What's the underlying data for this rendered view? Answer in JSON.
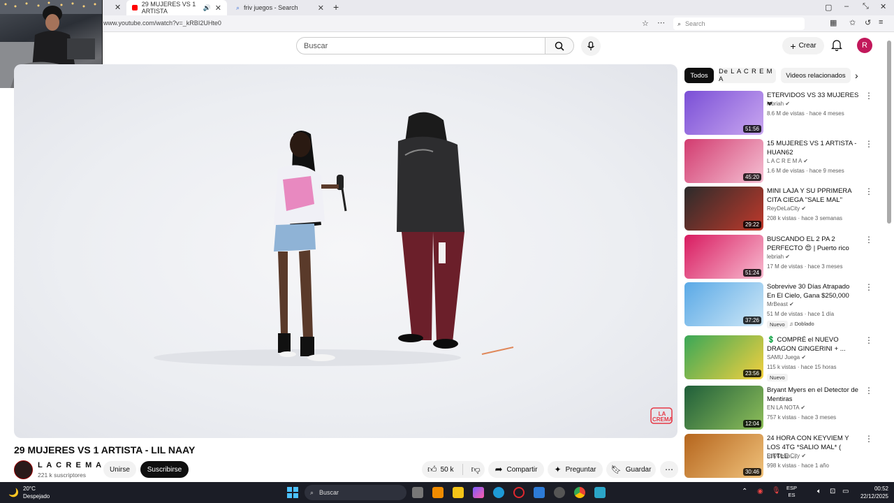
{
  "browser": {
    "tabs": [
      {
        "title": "29 MUJERES VS 1 ARTISTA",
        "active": true
      },
      {
        "title": "friv juegos - Search",
        "active": false
      }
    ],
    "url": "www.youtube.com/watch?v=_kRBI2UHte0",
    "search_placeholder": "Search"
  },
  "header": {
    "search_placeholder": "Buscar",
    "create_label": "Crear",
    "avatar_letter": "R"
  },
  "video": {
    "title": "29 MUJERES VS 1 ARTISTA - LIL NAAY",
    "watermark": "LA CREMA",
    "channel_name": "L A C R E M A",
    "subscribers": "221 k suscriptores",
    "join_label": "Unirse",
    "subscribe_label": "Suscribirse",
    "likes": "50 k",
    "share_label": "Compartir",
    "ask_label": "Preguntar",
    "save_label": "Guardar"
  },
  "chips": [
    "Todos",
    "De L A C R E M A",
    "Videos relacionados"
  ],
  "recommendations": [
    {
      "title": "ETERVIDOS VS 33 MUJERES ❤",
      "channel": "lebriah",
      "meta": "8.6 M de vistas · hace 4 meses",
      "duration": "51:56",
      "thumb_colors": [
        "#7a4fd6",
        "#c9a7f0"
      ]
    },
    {
      "title": "15 MUJERES VS 1 ARTISTA - HUAN62",
      "channel": "L A C R E M A",
      "meta": "1.6 M de vistas · hace 9 meses",
      "duration": "45:20",
      "thumb_colors": [
        "#d23b6f",
        "#f5c1d4"
      ]
    },
    {
      "title": "MINI LAJA Y SU PPRIMERA CITA CIEGA \"SALE MAL\"",
      "channel": "ReyDeLaCity",
      "meta": "208 k vistas · hace 3 semanas",
      "duration": "29:22",
      "thumb_colors": [
        "#2b2b2b",
        "#c0392b"
      ]
    },
    {
      "title": "BUSCANDO EL 2 PA 2 PERFECTO 😍 | Puerto rico",
      "channel": "lebriah",
      "meta": "17 M de vistas · hace 3 meses",
      "duration": "51:24",
      "thumb_colors": [
        "#d81b60",
        "#f8bbd0"
      ]
    },
    {
      "title": "Sobrevive 30 Días Atrapado En El Cielo, Gana $250,000",
      "channel": "MrBeast",
      "meta": "51 M de vistas · hace 1 día",
      "duration": "37:26",
      "badge": "Nuevo",
      "badge2": "Doblado",
      "thumb_colors": [
        "#5aa9e6",
        "#cfe8f7"
      ]
    },
    {
      "title": "💲 COMPRÉ el NUEVO DRAGON GINGERINI + ...",
      "channel": "SAMU Juega",
      "meta": "115 k vistas · hace 15 horas",
      "duration": "23:56",
      "badge": "Nuevo",
      "thumb_colors": [
        "#3aa757",
        "#f4d03f"
      ]
    },
    {
      "title": "Bryant Myers en el Detector de Mentiras",
      "channel": "EN LA NOTA",
      "meta": "757 k vistas · hace 3 meses",
      "duration": "12:04",
      "thumb_colors": [
        "#1f5e3a",
        "#8fbf5a"
      ]
    },
    {
      "title": "24 HORA CON KEYVIEM Y LOS 4TG *SALIO MAL* ( LITTLE ...",
      "channel": "ReyDeLaCity",
      "meta": "998 k vistas · hace 1 año",
      "duration": "30:46",
      "thumb_colors": [
        "#b5651d",
        "#f0c27b"
      ]
    }
  ],
  "taskbar": {
    "temperature": "20°C",
    "weather": "Despejado",
    "search_label": "Buscar",
    "lang_1": "ESP",
    "lang_2": "ES",
    "time": "00:52",
    "date": "22/12/2025"
  }
}
